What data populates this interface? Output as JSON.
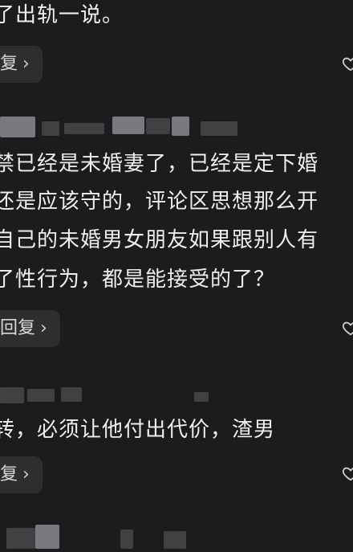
{
  "comments": [
    {
      "lines": [
        "了出轨一说。"
      ],
      "reply_label": "复"
    },
    {
      "lines": [
        "禁已经是未婚妻了，已经是定下婚",
        "还是应该守的，评论区思想那么开",
        "自己的未婚男女朋友如果跟别人有",
        "了性行为，都是能接受的了？"
      ],
      "reply_label": "回复"
    },
    {
      "lines": [
        "转，必须让他付出代价，渣男"
      ],
      "reply_label": "复"
    }
  ],
  "icons": {
    "reply_chevron": "chevron-right-icon",
    "like": "heart-outline-icon"
  }
}
